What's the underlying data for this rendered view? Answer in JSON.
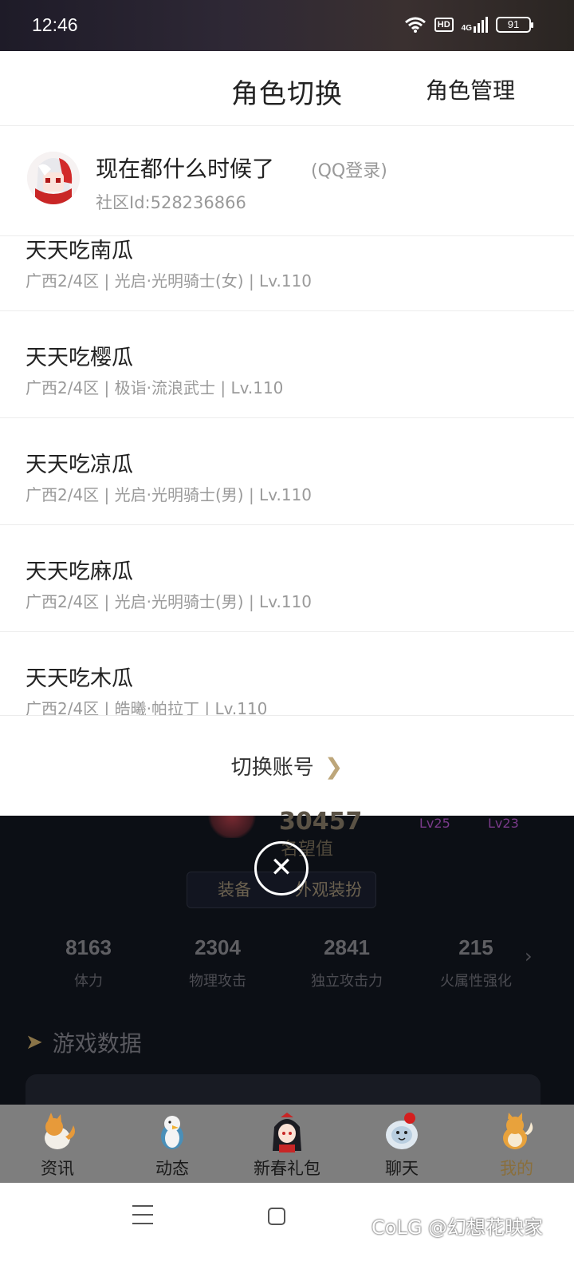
{
  "status_bar": {
    "time": "12:46",
    "hd": "HD",
    "network": "4G",
    "battery": "91",
    "icons": [
      "wifi-icon",
      "hd-icon",
      "signal-icon",
      "battery-icon"
    ]
  },
  "sheet": {
    "title": "角色切换",
    "manage_label": "角色管理",
    "account": {
      "name": "现在都什么时候了",
      "login_type": "(QQ登录)",
      "id_text": "社区Id:528236866"
    },
    "roles": [
      {
        "name": "天天吃南瓜",
        "info": "广西2/4区 | 光启·光明骑士(女) | Lv.110"
      },
      {
        "name": "天天吃樱瓜",
        "info": "广西2/4区 | 极诣·流浪武士 | Lv.110"
      },
      {
        "name": "天天吃凉瓜",
        "info": "广西2/4区 | 光启·光明骑士(男) | Lv.110"
      },
      {
        "name": "天天吃麻瓜",
        "info": "广西2/4区 | 光启·光明骑士(男) | Lv.110"
      },
      {
        "name": "天天吃木瓜",
        "info": "广西2/4区 | 皓曦·帕拉丁 | Lv.110"
      }
    ],
    "switch_account_label": "切换账号",
    "chevron": "❯"
  },
  "background": {
    "fame_value": "30457",
    "fame_label": "名望值",
    "levels": [
      "Lv25",
      "Lv23"
    ],
    "equip_tabs": [
      "装备",
      "外观装扮"
    ],
    "stats": [
      {
        "value": "8163",
        "label": "体力"
      },
      {
        "value": "2304",
        "label": "物理攻击"
      },
      {
        "value": "2841",
        "label": "独立攻击力"
      },
      {
        "value": "215",
        "label": "火属性强化"
      }
    ],
    "section_title": "游戏数据"
  },
  "close_symbol": "✕",
  "tabbar": {
    "tabs": [
      {
        "label": "资讯",
        "icon": "fox-mascot-icon"
      },
      {
        "label": "动态",
        "icon": "penguin-mascot-icon"
      },
      {
        "label": "新春礼包",
        "icon": "girl-mascot-icon"
      },
      {
        "label": "聊天",
        "icon": "yeti-mascot-icon"
      },
      {
        "label": "我的",
        "icon": "shiba-mascot-icon"
      }
    ],
    "active_index": 4
  },
  "watermark": "CoLG @幻想花映家",
  "colors": {
    "accent_gold": "#bda67a",
    "active_tab": "#8a6f3c",
    "badge_red": "#d41e1e"
  }
}
